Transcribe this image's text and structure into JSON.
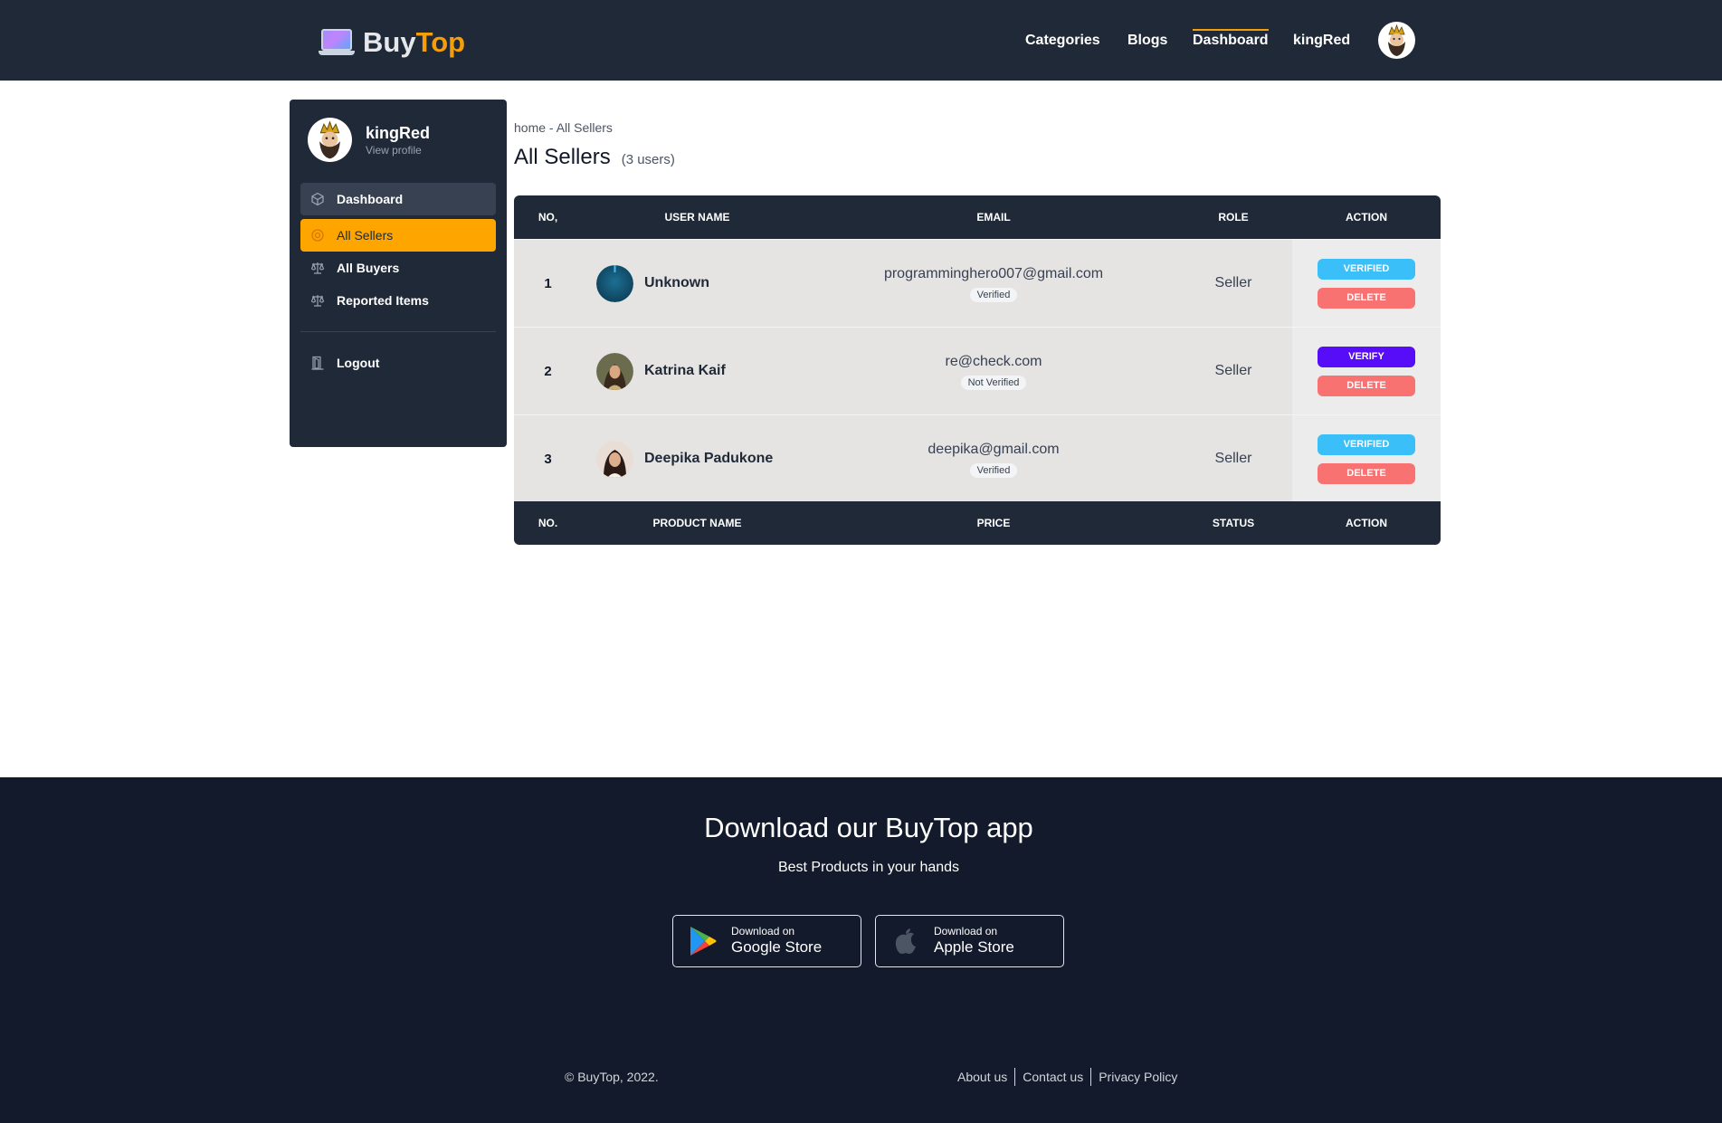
{
  "header": {
    "brand_first": "Buy",
    "brand_second": "Top",
    "nav": [
      "Categories",
      "Blogs",
      "Dashboard",
      "kingRed"
    ],
    "active_nav": "Dashboard"
  },
  "sidebar": {
    "profile_name": "kingRed",
    "profile_link": "View profile",
    "items": [
      {
        "label": "Dashboard",
        "icon": "cube-icon"
      },
      {
        "label": "All Sellers",
        "icon": "gear-icon"
      },
      {
        "label": "All Buyers",
        "icon": "scale-icon"
      },
      {
        "label": "Reported Items",
        "icon": "scale-icon"
      },
      {
        "label": "Logout",
        "icon": "door-icon"
      }
    ],
    "active_item": "All Sellers"
  },
  "main": {
    "breadcrumb": "home - All Sellers",
    "title": "All Sellers",
    "count": "(3 users)",
    "table_headers": [
      "NO,",
      "USER NAME",
      "EMAIL",
      "ROLE",
      "ACTION"
    ],
    "rows": [
      {
        "no": "1",
        "name": "Unknown",
        "email": "programminghero007@gmail.com",
        "status": "Verified",
        "role": "Seller",
        "primary_action": "VERIFIED",
        "delete": "DELETE"
      },
      {
        "no": "2",
        "name": "Katrina Kaif",
        "email": "re@check.com",
        "status": "Not Verified",
        "role": "Seller",
        "primary_action": "VERIFY",
        "delete": "DELETE"
      },
      {
        "no": "3",
        "name": "Deepika Padukone",
        "email": "deepika@gmail.com",
        "status": "Verified",
        "role": "Seller",
        "primary_action": "VERIFIED",
        "delete": "DELETE"
      }
    ],
    "footer_headers": [
      "NO.",
      "PRODUCT NAME",
      "PRICE",
      "STATUS",
      "ACTION"
    ]
  },
  "footer": {
    "title": "Download our BuyTop app",
    "subtitle": "Best Products in your hands",
    "google_small": "Download on",
    "google_big": "Google Store",
    "apple_small": "Download on",
    "apple_big": "Apple Store",
    "copyright": "© BuyTop, 2022.",
    "links": [
      "About us",
      "Contact us",
      "Privacy Policy"
    ]
  },
  "colors": {
    "navbar": "#1f2937",
    "accent": "#ffa500",
    "verified": "#3abff8",
    "verify": "#570df8",
    "delete": "#f87272",
    "footer": "#131a2b"
  }
}
